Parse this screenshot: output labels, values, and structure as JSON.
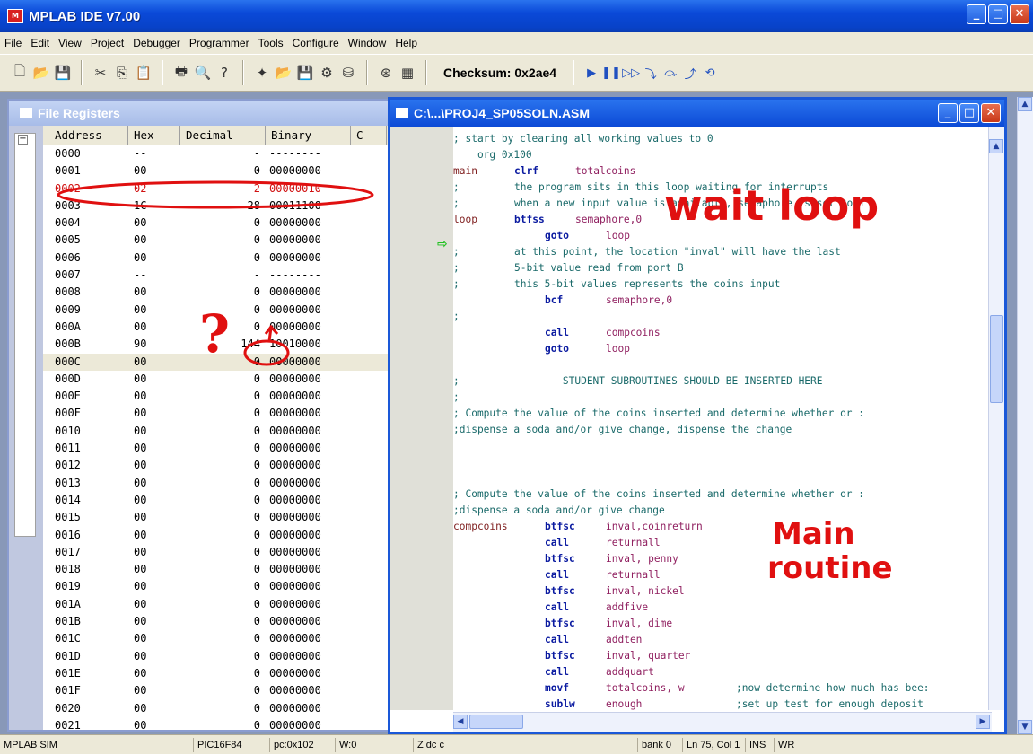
{
  "app": {
    "title": "MPLAB IDE v7.00"
  },
  "menu": [
    "File",
    "Edit",
    "View",
    "Project",
    "Debugger",
    "Programmer",
    "Tools",
    "Configure",
    "Window",
    "Help"
  ],
  "toolbar": {
    "checksum": "Checksum:  0x2ae4"
  },
  "file_registers": {
    "title": "File Registers",
    "columns": [
      "Address",
      "Hex",
      "Decimal",
      "Binary",
      "C"
    ],
    "rows": [
      [
        "0000",
        "--",
        "-",
        "--------"
      ],
      [
        "0001",
        "00",
        "0",
        "00000000"
      ],
      [
        "0002",
        "02",
        "2",
        "00000010"
      ],
      [
        "0003",
        "1C",
        "28",
        "00011100"
      ],
      [
        "0004",
        "00",
        "0",
        "00000000"
      ],
      [
        "0005",
        "00",
        "0",
        "00000000"
      ],
      [
        "0006",
        "00",
        "0",
        "00000000"
      ],
      [
        "0007",
        "--",
        "-",
        "--------"
      ],
      [
        "0008",
        "00",
        "0",
        "00000000"
      ],
      [
        "0009",
        "00",
        "0",
        "00000000"
      ],
      [
        "000A",
        "00",
        "0",
        "00000000"
      ],
      [
        "000B",
        "90",
        "144",
        "10010000"
      ],
      [
        "000C",
        "00",
        "0",
        "00000000"
      ],
      [
        "000D",
        "00",
        "0",
        "00000000"
      ],
      [
        "000E",
        "00",
        "0",
        "00000000"
      ],
      [
        "000F",
        "00",
        "0",
        "00000000"
      ],
      [
        "0010",
        "00",
        "0",
        "00000000"
      ],
      [
        "0011",
        "00",
        "0",
        "00000000"
      ],
      [
        "0012",
        "00",
        "0",
        "00000000"
      ],
      [
        "0013",
        "00",
        "0",
        "00000000"
      ],
      [
        "0014",
        "00",
        "0",
        "00000000"
      ],
      [
        "0015",
        "00",
        "0",
        "00000000"
      ],
      [
        "0016",
        "00",
        "0",
        "00000000"
      ],
      [
        "0017",
        "00",
        "0",
        "00000000"
      ],
      [
        "0018",
        "00",
        "0",
        "00000000"
      ],
      [
        "0019",
        "00",
        "0",
        "00000000"
      ],
      [
        "001A",
        "00",
        "0",
        "00000000"
      ],
      [
        "001B",
        "00",
        "0",
        "00000000"
      ],
      [
        "001C",
        "00",
        "0",
        "00000000"
      ],
      [
        "001D",
        "00",
        "0",
        "00000000"
      ],
      [
        "001E",
        "00",
        "0",
        "00000000"
      ],
      [
        "001F",
        "00",
        "0",
        "00000000"
      ],
      [
        "0020",
        "00",
        "0",
        "00000000"
      ],
      [
        "0021",
        "00",
        "0",
        "00000000"
      ]
    ]
  },
  "source": {
    "title": "C:\\...\\PROJ4_SP05SOLN.ASM",
    "lines": [
      [
        "",
        "; start by clearing all working values to 0",
        "",
        ""
      ],
      [
        "",
        "    org 0x100",
        "",
        ""
      ],
      [
        "main",
        "clrf",
        "totalcoins",
        ""
      ],
      [
        "",
        ";",
        "the program sits in this loop waiting for interrupts",
        ""
      ],
      [
        "",
        ";",
        "when a new input value is available, semaphore is set to 1",
        ""
      ],
      [
        "loop",
        "btfss",
        "semaphore,0",
        ""
      ],
      [
        "",
        "goto",
        "loop",
        ""
      ],
      [
        "",
        ";",
        "at this point, the location \"inval\" will have the last",
        ""
      ],
      [
        "",
        ";",
        "5-bit value read from port B",
        ""
      ],
      [
        "",
        ";",
        "this 5-bit values represents the coins input",
        ""
      ],
      [
        "",
        "bcf",
        "semaphore,0",
        ""
      ],
      [
        "",
        ";",
        "",
        ""
      ],
      [
        "",
        "call",
        "compcoins",
        ""
      ],
      [
        "",
        "goto",
        "loop",
        ""
      ],
      [
        "",
        "",
        "",
        ""
      ],
      [
        "",
        ";",
        "        STUDENT SUBROUTINES SHOULD BE INSERTED HERE",
        ""
      ],
      [
        "",
        ";",
        "",
        ""
      ],
      [
        "",
        "; Compute the value of the coins inserted and determine whether or :",
        "",
        ""
      ],
      [
        "",
        ";dispense a soda and/or give change, dispense the change",
        "",
        ""
      ],
      [
        "",
        "",
        "",
        ""
      ],
      [
        "",
        "",
        "",
        ""
      ],
      [
        "",
        "",
        "",
        ""
      ],
      [
        "",
        "; Compute the value of the coins inserted and determine whether or :",
        "",
        ""
      ],
      [
        "",
        ";dispense a soda and/or give change",
        "",
        ""
      ],
      [
        "compcoins",
        "btfsc",
        "inval,coinreturn",
        ""
      ],
      [
        "",
        "call",
        "returnall",
        ""
      ],
      [
        "",
        "btfsc",
        "inval, penny",
        ""
      ],
      [
        "",
        "call",
        "returnall",
        ""
      ],
      [
        "",
        "btfsc",
        "inval, nickel",
        ""
      ],
      [
        "",
        "call",
        "addfive",
        ""
      ],
      [
        "",
        "btfsc",
        "inval, dime",
        ""
      ],
      [
        "",
        "call",
        "addten",
        ""
      ],
      [
        "",
        "btfsc",
        "inval, quarter",
        ""
      ],
      [
        "",
        "call",
        "addquart",
        ""
      ],
      [
        "",
        "movf",
        "totalcoins, w",
        ";now determine how much has bee:"
      ],
      [
        "",
        "sublw",
        "enough",
        ";set up test for enough deposit"
      ]
    ]
  },
  "annotations": {
    "wait_loop": "wait loop",
    "main_routine_1": "Main",
    "main_routine_2": "routine",
    "question": "?"
  },
  "status": {
    "debugger": "MPLAB SIM",
    "device": "PIC16F84",
    "pc": "pc:0x102",
    "w": "W:0",
    "flags": "Z dc c",
    "bank": "bank 0",
    "position": "Ln 75, Col 1",
    "ins": "INS",
    "wr": "WR"
  }
}
